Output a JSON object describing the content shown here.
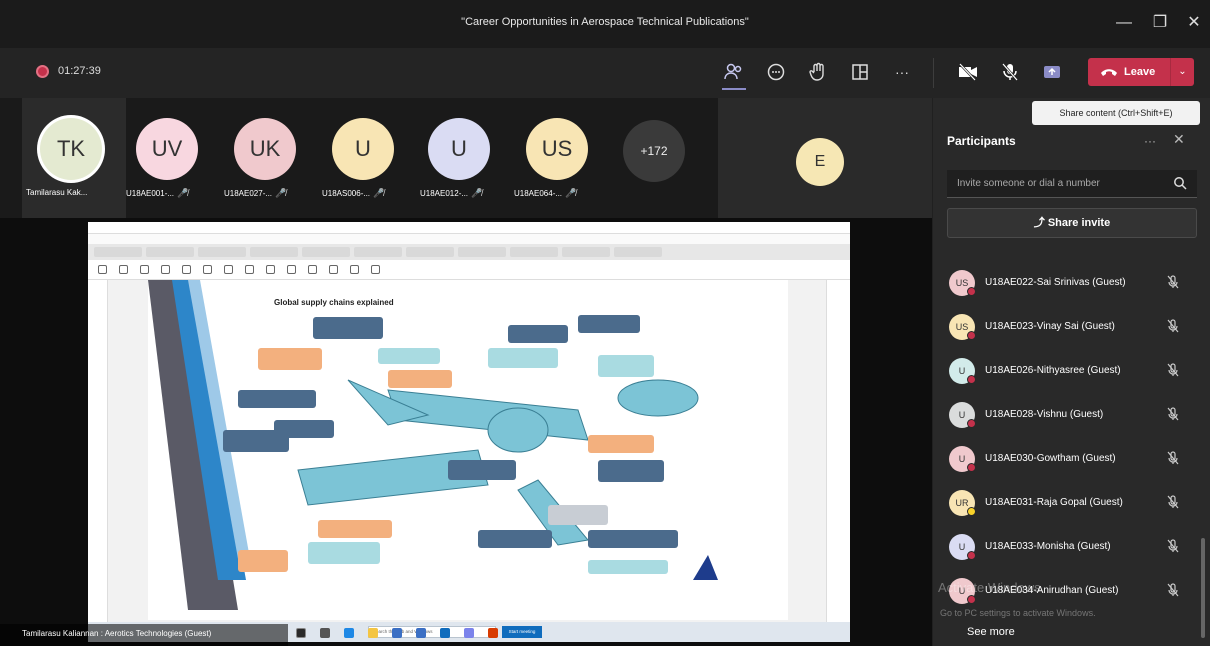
{
  "window": {
    "title": "\"Career Opportunities in Aerospace Technical Publications\"",
    "minimize_glyph": "—",
    "maximize_glyph": "❐",
    "close_glyph": "✕"
  },
  "toolbar": {
    "timer": "01:27:39",
    "more_glyph": "···",
    "leave_label": "Leave",
    "leave_chevron": "⌄"
  },
  "tooltip": "Share content (Ctrl+Shift+E)",
  "gallery": {
    "tiles": [
      {
        "initials": "TK",
        "name": "Tamilarasu Kak...",
        "color": "#e4ead1",
        "muted": false
      },
      {
        "initials": "UV",
        "name": "U18AE001-...",
        "color": "#f8d7e0",
        "muted": true
      },
      {
        "initials": "UK",
        "name": "U18AE027-...",
        "color": "#f0c9cd",
        "muted": true
      },
      {
        "initials": "U",
        "name": "U18AS006-...",
        "color": "#f8e5b4",
        "muted": true
      },
      {
        "initials": "U",
        "name": "U18AE012-...",
        "color": "#dadcf3",
        "muted": true
      },
      {
        "initials": "US",
        "name": "U18AE064-...",
        "color": "#f8e5b4",
        "muted": true
      }
    ],
    "overflow": "+172",
    "e_initial": "E"
  },
  "shared": {
    "heading": "Global supply chains explained",
    "search_placeholder": "Search the web and Windows",
    "search_button": "Start meeting"
  },
  "presenter": "Tamilarasu Kaliannan : Aerotics Technologies (Guest)",
  "panel": {
    "title": "Participants",
    "more": "···",
    "close": "✕",
    "search_placeholder": "Invite someone or dial a number",
    "share_invite": "Share invite",
    "share_glyph": "⤴",
    "participants": [
      {
        "initials": "US",
        "name": "U18AE022-Sai Srinivas (Guest)",
        "color": "#f0c9cd",
        "badge": "dnd"
      },
      {
        "initials": "US",
        "name": "U18AE023-Vinay Sai (Guest)",
        "color": "#f8e5b4",
        "badge": "dnd"
      },
      {
        "initials": "U",
        "name": "U18AE026-Nithyasree (Guest)",
        "color": "#d2ebea",
        "badge": "dnd"
      },
      {
        "initials": "U",
        "name": "U18AE028-Vishnu (Guest)",
        "color": "#dadcdc",
        "badge": "dnd"
      },
      {
        "initials": "U",
        "name": "U18AE030-Gowtham (Guest)",
        "color": "#f0c9cd",
        "badge": "dnd"
      },
      {
        "initials": "UR",
        "name": "U18AE031-Raja Gopal (Guest)",
        "color": "#f8e5b4",
        "badge": "away"
      },
      {
        "initials": "U",
        "name": "U18AE033-Monisha (Guest)",
        "color": "#dadcf3",
        "badge": "dnd"
      },
      {
        "initials": "U",
        "name": "U18AE034-Anirudhan (Guest)",
        "color": "#f0c9cd",
        "badge": "dnd"
      }
    ],
    "see_more": "See more"
  },
  "watermark": {
    "line1": "Activate Windows",
    "line2": "Go to PC settings to activate Windows."
  }
}
